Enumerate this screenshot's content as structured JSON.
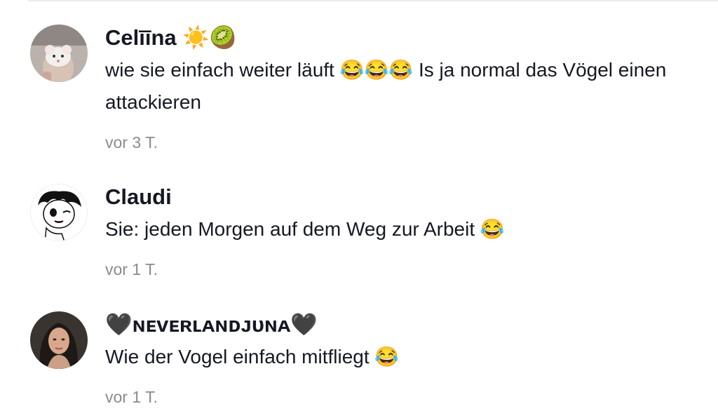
{
  "comments": [
    {
      "username": "Celīīna ☀️🥝",
      "text": "wie sie einfach weiter läuft 😂😂😂 Is ja normal das Vögel einen attackieren",
      "time": "vor 3 T.",
      "avatar_icon": "rat-photo-avatar"
    },
    {
      "username": "Claudi",
      "text": "Sie: jeden Morgen auf dem Weg zur Arbeit 😂",
      "time": "vor 1 T.",
      "avatar_icon": "betty-boop-avatar"
    },
    {
      "username": "🖤ɴᴇᴠᴇʀʟᴀɴᴅᴊᴜɴᴀ🖤",
      "text": "Wie der Vogel einfach mitfliegt 😂",
      "time": "vor 1 T.",
      "avatar_icon": "woman-photo-avatar"
    }
  ]
}
